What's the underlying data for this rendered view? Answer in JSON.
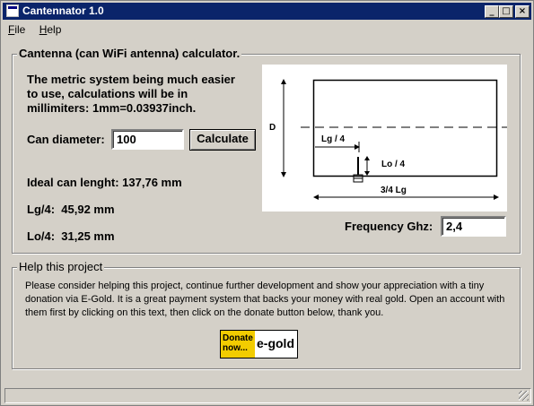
{
  "window": {
    "title": "Cantennator 1.0"
  },
  "menu": {
    "file": "File",
    "help": "Help"
  },
  "calculator": {
    "group_title": "Cantenna (can WiFi antenna) calculator.",
    "intro_lines": [
      "The metric system being much easier",
      "to use, calculations will be in",
      "millimiters: 1mm=0.03937inch."
    ],
    "can_diameter_label": "Can diameter:",
    "can_diameter_value": "100",
    "calculate_button": "Calculate",
    "ideal_can_length": "Ideal can lenght: 137,76 mm",
    "lg4": "Lg/4:  45,92 mm",
    "lo4": "Lo/4:  31,25 mm",
    "frequency_label": "Frequency Ghz:",
    "frequency_value": "2,4"
  },
  "diagram": {
    "label_d": "D",
    "label_lg4": "Lg / 4",
    "label_lo4": "Lo / 4",
    "label_34lg": "3/4 Lg"
  },
  "help_project": {
    "group_title": "Help this project",
    "text": "Please consider helping this project, continue further development and show your appreciation with a tiny donation via E-Gold. It is a great payment system that backs your money with real gold. Open an account with them first by clicking on this text, then click on the donate button below, thank you.",
    "donate_line1": "Donate",
    "donate_line2": "now...",
    "donate_brand": "e-gold",
    "donate_color": "#f2cc00"
  },
  "icons": [
    "app-icon",
    "minimize-icon",
    "maximize-icon",
    "close-icon",
    "resize-grip-icon"
  ]
}
